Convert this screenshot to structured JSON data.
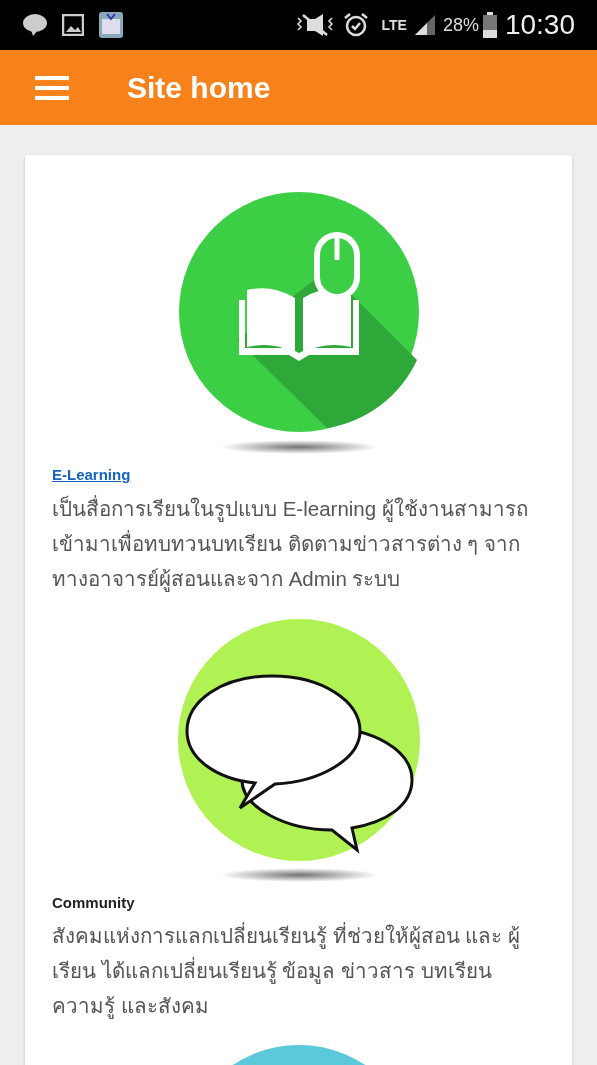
{
  "status_bar": {
    "network": "LTE",
    "battery": "28%",
    "time": "10:30"
  },
  "app_bar": {
    "title": "Site home"
  },
  "items": [
    {
      "kind": "book",
      "title": "E-Learning",
      "linked": true,
      "description": "เป็นสื่อการเรียนในรูปแบบ E-learning ผู้ใช้งานสามารถเข้ามาเพื่อทบทวนบทเรียน ติดตามข่าวสารต่าง ๆ จากทางอาจารย์ผู้สอนและจาก Admin ระบบ"
    },
    {
      "kind": "chat",
      "title": "Community",
      "linked": false,
      "description": "สังคมแห่งการแลกเปลี่ยนเรียนรู้ ที่ช่วยให้ผู้สอน และ ผู้เรียน ได้แลกเปลี่ยนเรียนรู้ ข้อมูล ข่าวสาร บทเรียน ความรู้ และสังคม"
    },
    {
      "kind": "partial"
    }
  ]
}
